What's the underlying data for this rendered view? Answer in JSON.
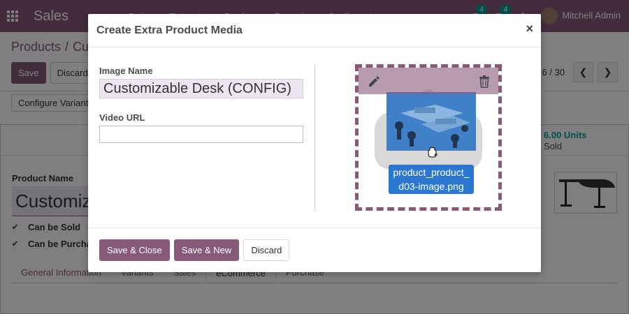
{
  "navbar": {
    "app_title": "Sales",
    "menu": [
      "Orders",
      "To Invoice",
      "Products",
      "Reporting",
      "Configuration"
    ],
    "activity_count": "4",
    "messages_count": "4",
    "user_name": "Mitchell Admin"
  },
  "breadcrumb": {
    "parent": "Products",
    "current": "Cu"
  },
  "control_panel": {
    "save_label": "Save",
    "discard_label": "Discard",
    "pager_value": "6 / 30",
    "configure_variants_label": "Configure Variant"
  },
  "smart_button": {
    "value": "6.00 Units",
    "label": "Sold"
  },
  "form": {
    "product_name_label": "Product Name",
    "product_name_value": "Customiz",
    "can_be_sold": "Can be Sold",
    "can_be_purchased": "Can be Purcha"
  },
  "tabs": [
    "General Information",
    "Variants",
    "Sales",
    "eCommerce",
    "Purchase"
  ],
  "active_tab_index": 3,
  "modal": {
    "title": "Create Extra Product Media",
    "close_glyph": "×",
    "image_name_label": "Image Name",
    "image_name_value": "Customizable Desk (CONFIG)",
    "video_url_label": "Video URL",
    "video_url_value": "",
    "drag_filename_line1": "product_product_",
    "drag_filename_line2": "d03-image.png",
    "save_close_label": "Save & Close",
    "save_new_label": "Save & New",
    "discard_label": "Discard"
  },
  "colors": {
    "brand": "#875a7b",
    "accent": "#00a09d",
    "drag_blue": "#2c78d0"
  }
}
